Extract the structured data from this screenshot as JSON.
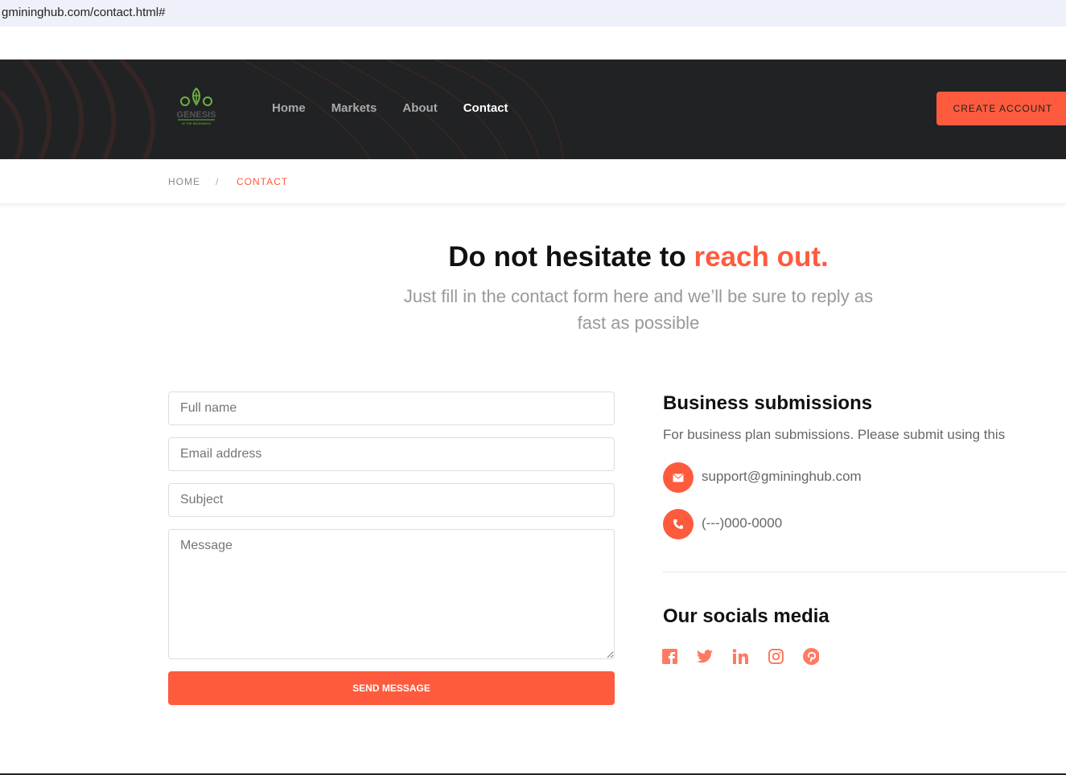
{
  "browser": {
    "url": "gmininghub.com/contact.html#"
  },
  "logo": {
    "text": "GENESIS",
    "tagline": "IN THE BEGINNING"
  },
  "nav": {
    "items": [
      {
        "label": "Home"
      },
      {
        "label": "Markets"
      },
      {
        "label": "About"
      },
      {
        "label": "Contact"
      }
    ],
    "cta": "CREATE ACCOUNT"
  },
  "breadcrumb": {
    "home": "HOME",
    "sep": "/",
    "current": "CONTACT"
  },
  "hero": {
    "title_main": "Do not hesitate to ",
    "title_accent": "reach out.",
    "subtitle": "Just fill in the contact form here and we’ll be sure to reply as fast as possible"
  },
  "form": {
    "name_placeholder": "Full name",
    "email_placeholder": "Email address",
    "subject_placeholder": "Subject",
    "message_placeholder": "Message",
    "submit": "SEND MESSAGE"
  },
  "business": {
    "title": "Business submissions",
    "desc": "For business plan submissions. Please submit using this",
    "email": "support@gmininghub.com",
    "phone": "(---)000-0000"
  },
  "socials": {
    "title": "Our socials media",
    "icons": [
      "facebook-icon",
      "twitter-icon",
      "linkedin-icon",
      "instagram-icon",
      "pinterest-icon"
    ]
  },
  "colors": {
    "accent": "#fe5b3e",
    "header_bg": "#212224",
    "logo_green": "#6cb33f"
  }
}
